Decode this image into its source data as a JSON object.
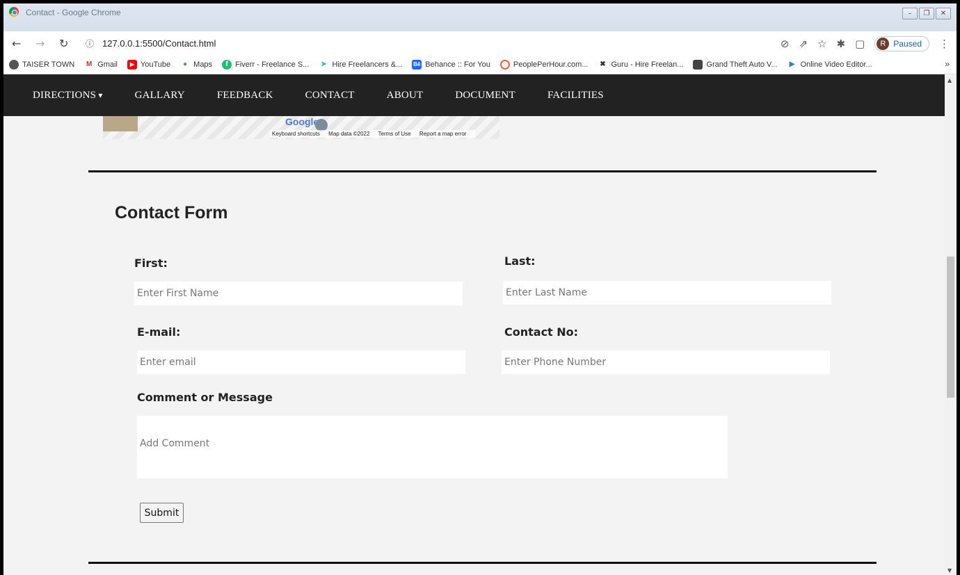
{
  "browser": {
    "window_title": "Contact - Google Chrome",
    "url": "127.0.0.1:5500/Contact.html",
    "profile_initial": "R",
    "profile_status": "Paused",
    "bookmarks": [
      {
        "label": "TAISER TOWN",
        "icon": "globe-icon",
        "color": "#555555"
      },
      {
        "label": "Gmail",
        "icon": "gmail-icon",
        "color": "#d93025"
      },
      {
        "label": "YouTube",
        "icon": "youtube-icon",
        "color": "#ff0000"
      },
      {
        "label": "Maps",
        "icon": "maps-icon",
        "color": "#34a853"
      },
      {
        "label": "Fiverr - Freelance S...",
        "icon": "fiverr-icon",
        "color": "#1dbf73"
      },
      {
        "label": "Hire Freelancers &...",
        "icon": "freelancer-icon",
        "color": "#29b2fe"
      },
      {
        "label": "Behance :: For You",
        "icon": "behance-icon",
        "color": "#1769ff"
      },
      {
        "label": "PeoplePerHour.com...",
        "icon": "pph-icon",
        "color": "#ff5a36"
      },
      {
        "label": "Guru - Hire Freelan...",
        "icon": "guru-icon",
        "color": "#333333"
      },
      {
        "label": "Grand Theft Auto V...",
        "icon": "gta-icon",
        "color": "#444444"
      },
      {
        "label": "Online Video Editor...",
        "icon": "video-editor-icon",
        "color": "#3a7bd5"
      }
    ],
    "more_bookmarks": "»"
  },
  "nav": {
    "items": [
      "DIRECTIONS",
      "GALLARY",
      "FEEDBACK",
      "CONTACT",
      "ABOUT",
      "DOCUMENT",
      "FACILITIES"
    ]
  },
  "map": {
    "brand": "Google",
    "footer": [
      "Keyboard shortcuts",
      "Map data ©2022",
      "Terms of Use",
      "Report a map error"
    ]
  },
  "form": {
    "title": "Contact Form",
    "first_label": "First:",
    "first_placeholder": "Enter First Name",
    "last_label": "Last:",
    "last_placeholder": "Enter Last Name",
    "email_label": "E-mail:",
    "email_placeholder": "Enter email",
    "phone_label": "Contact No:",
    "phone_placeholder": "Enter Phone Number",
    "comment_label": "Comment or Message",
    "comment_placeholder": "Add Comment",
    "submit_label": "Submit"
  }
}
